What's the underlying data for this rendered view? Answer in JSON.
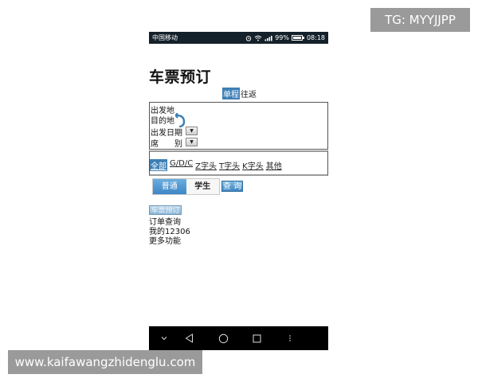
{
  "watermarks": {
    "top_right": "TG: MYYJJPP",
    "bottom_left": "www.kaifawangzhidenglu.com"
  },
  "status_bar": {
    "carrier": "中国移动",
    "battery": "99%",
    "time": "08:18"
  },
  "page": {
    "title": "车票预订"
  },
  "trip_type": {
    "selected": "单程",
    "other": "往返"
  },
  "search_form": {
    "from_label": "出发地",
    "to_label": "目的地",
    "date_label": "出发日期",
    "seat_label": "席　　别",
    "select_arrow": "▼"
  },
  "train_filter": {
    "items": [
      "全部",
      "G/D/C",
      "Z字头",
      "T字头",
      "K字头",
      "其他"
    ],
    "selected_index": 0
  },
  "ticket_type": {
    "tabs": [
      "普通",
      "学生"
    ],
    "selected_index": 0
  },
  "query_button": "查 询",
  "menu": {
    "active_tab": "车票预订",
    "items": [
      "订单查询",
      "我的12306",
      "更多功能"
    ]
  },
  "colors": {
    "accent_blue": "#3e7fb5",
    "status_bar_bg": "#15212a",
    "nav_bar_bg": "#000000",
    "watermark_bg": "#9a9a9a"
  },
  "icons": {
    "swap": "swap-arrow-icon",
    "nav_down": "chevron-down-icon",
    "nav_back": "back-triangle-icon",
    "nav_home": "home-circle-icon",
    "nav_recent": "recent-square-icon",
    "nav_more": "more-dots-icon"
  }
}
